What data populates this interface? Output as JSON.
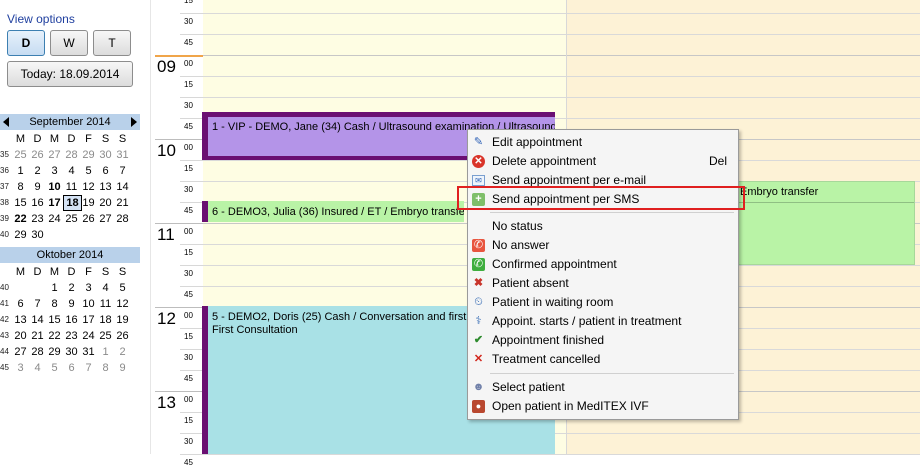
{
  "sidebar": {
    "view_options": "View options",
    "view_buttons": [
      "D",
      "W",
      "T"
    ],
    "today_label": "Today: 18.09.2014"
  },
  "calendar1": {
    "title": "September 2014",
    "weekdays": [
      "M",
      "D",
      "M",
      "D",
      "F",
      "S",
      "S"
    ],
    "weeks": [
      {
        "wk": "35",
        "days": [
          "25",
          "26",
          "27",
          "28",
          "29",
          "30",
          "31"
        ]
      },
      {
        "wk": "36",
        "days": [
          "1",
          "2",
          "3",
          "4",
          "5",
          "6",
          "7"
        ]
      },
      {
        "wk": "37",
        "days": [
          "8",
          "9",
          "10",
          "11",
          "12",
          "13",
          "14"
        ]
      },
      {
        "wk": "38",
        "days": [
          "15",
          "16",
          "17",
          "18",
          "19",
          "20",
          "21"
        ]
      },
      {
        "wk": "39",
        "days": [
          "22",
          "23",
          "24",
          "25",
          "26",
          "27",
          "28"
        ]
      },
      {
        "wk": "40",
        "days": [
          "29",
          "30",
          "",
          "",
          "",
          "",
          ""
        ]
      }
    ],
    "selected": "18"
  },
  "calendar2": {
    "title": "Oktober 2014",
    "weekdays": [
      "M",
      "D",
      "M",
      "D",
      "F",
      "S",
      "S"
    ],
    "weeks": [
      {
        "wk": "40",
        "days": [
          "",
          "",
          "1",
          "2",
          "3",
          "4",
          "5"
        ]
      },
      {
        "wk": "41",
        "days": [
          "6",
          "7",
          "8",
          "9",
          "10",
          "11",
          "12"
        ]
      },
      {
        "wk": "42",
        "days": [
          "13",
          "14",
          "15",
          "16",
          "17",
          "18",
          "19"
        ]
      },
      {
        "wk": "43",
        "days": [
          "20",
          "21",
          "22",
          "23",
          "24",
          "25",
          "26"
        ]
      },
      {
        "wk": "44",
        "days": [
          "27",
          "28",
          "29",
          "30",
          "31",
          "1",
          "2"
        ]
      },
      {
        "wk": "45",
        "days": [
          "3",
          "4",
          "5",
          "6",
          "7",
          "8",
          "9"
        ]
      }
    ]
  },
  "schedule": {
    "hours": [
      "09",
      "10",
      "11",
      "12",
      "13"
    ],
    "minutes": [
      "00",
      "15",
      "30",
      "45"
    ],
    "appointments": [
      {
        "text": "1 - VIP - DEMO, Jane (34) Cash / Ultrasound examination / Ultrasound",
        "color": "#b494e8",
        "bar": "#6a0f72"
      },
      {
        "text": "6 - DEMO3, Julia (36) Insured / ET / Embryo transfer",
        "color": "#b9f3a6",
        "bar": "#6a0f72"
      },
      {
        "text": "5 - DEMO2, Doris (25) Cash / Conversation and first c",
        "text2": "First Consultation",
        "color": "#a9e1e6",
        "bar": "#6a0f72"
      },
      {
        "text": "Embryo transfer",
        "color": "#b9f3a6"
      }
    ]
  },
  "context_menu": {
    "items": [
      {
        "label": "Edit appointment",
        "icon": "edit-icon",
        "shortcut": ""
      },
      {
        "label": "Delete appointment",
        "icon": "delete-icon",
        "shortcut": "Del"
      },
      {
        "label": "Send appointment per e-mail",
        "icon": "email-icon",
        "shortcut": ""
      },
      {
        "label": "Send appointment per SMS",
        "icon": "sms-icon",
        "shortcut": ""
      },
      {
        "label": "No status",
        "icon": "",
        "shortcut": ""
      },
      {
        "label": "No answer",
        "icon": "no-answer-icon",
        "shortcut": ""
      },
      {
        "label": "Confirmed appointment",
        "icon": "confirmed-icon",
        "shortcut": ""
      },
      {
        "label": "Patient absent",
        "icon": "patient-absent-icon",
        "shortcut": ""
      },
      {
        "label": "Patient in waiting room",
        "icon": "waiting-room-icon",
        "shortcut": ""
      },
      {
        "label": "Appoint. starts / patient in treatment",
        "icon": "treatment-icon",
        "shortcut": ""
      },
      {
        "label": "Appointment finished",
        "icon": "check-icon",
        "shortcut": ""
      },
      {
        "label": "Treatment cancelled",
        "icon": "cancel-icon",
        "shortcut": ""
      },
      {
        "label": "Select patient",
        "icon": "select-patient-icon",
        "shortcut": ""
      },
      {
        "label": "Open patient in MedITEX IVF",
        "icon": "open-patient-icon",
        "shortcut": ""
      }
    ]
  },
  "colors": {
    "column1_bg": "#fefde3",
    "column2_bg": "#fdf2d6",
    "highlight": "#e02020",
    "calendar_header": "#b9d1ea"
  }
}
